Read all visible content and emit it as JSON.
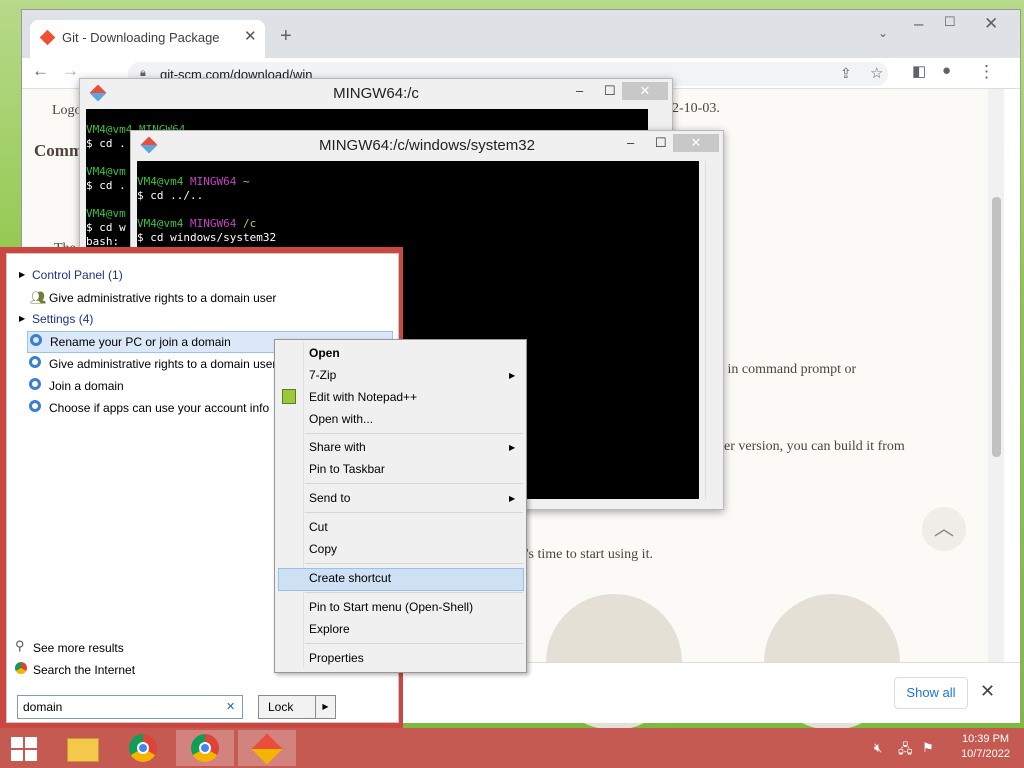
{
  "browser": {
    "tab_title": "Git - Downloading Package",
    "url": "git-scm.com/download/win",
    "page_fragments": {
      "logo": "Logo",
      "heading": "Comm",
      "the": "The",
      "date_suffix": "2-10-03.",
      "line1": "d in command prompt or",
      "line2": "ver version, you can build it from",
      "line3": "'s time to start using it."
    },
    "download_bar": {
      "show_all": "Show all",
      "close": "✕"
    }
  },
  "terminal_back": {
    "title": "MINGW64:/c",
    "lines": [
      "VM4@vm4 MINGW64",
      "$ cd .",
      "",
      "VM4@vm",
      "$ cd .",
      "",
      "VM4@vm",
      "$ cd w",
      "bash:"
    ]
  },
  "terminal_front": {
    "title": "MINGW64:/c/windows/system32",
    "prompt1_user": "VM4@vm4",
    "prompt1_host": "MINGW64",
    "prompt1_path": "~",
    "cmd1": "$ cd ../..",
    "prompt2_user": "VM4@vm4",
    "prompt2_host": "MINGW64",
    "prompt2_path": "/c",
    "cmd2": "$ cd windows/system32"
  },
  "start_menu": {
    "group_control_panel": "Control Panel (1)",
    "cp_item": "Give administrative rights to a domain user",
    "group_settings": "Settings (4)",
    "settings_items": [
      "Rename your PC or join a domain",
      "Give administrative rights to a domain user",
      "Join a domain",
      "Choose if apps can use your account info"
    ],
    "see_more": "See more results",
    "search_internet": "Search the Internet",
    "search_value": "domain",
    "search_clear": "✕",
    "lock_label": "Lock"
  },
  "context_menu": {
    "open": "Open",
    "zip": "7-Zip",
    "edit_notepad": "Edit with Notepad++",
    "open_with": "Open with...",
    "share_with": "Share with",
    "pin_taskbar": "Pin to Taskbar",
    "send_to": "Send to",
    "cut": "Cut",
    "copy": "Copy",
    "create_shortcut": "Create shortcut",
    "pin_start": "Pin to Start menu (Open-Shell)",
    "explore": "Explore",
    "properties": "Properties"
  },
  "taskbar": {
    "time": "10:39 PM",
    "date": "10/7/2022"
  },
  "colors": {
    "taskbar": "#c55a52",
    "start_menu_border": "#c94842",
    "terminal_green": "#3fc13f",
    "terminal_magenta": "#c343c3",
    "terminal_yellow": "#c8c846",
    "highlight": "#cde0f4"
  }
}
